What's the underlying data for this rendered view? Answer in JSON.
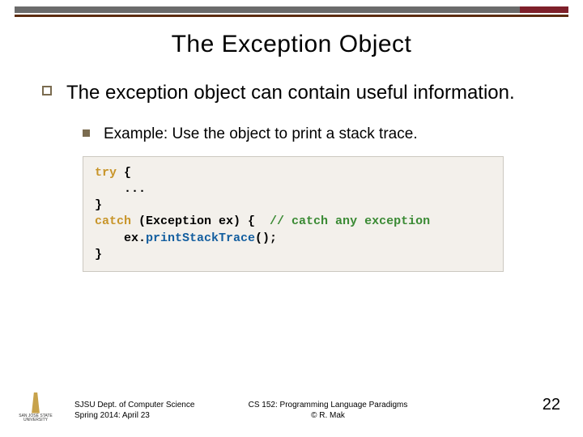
{
  "title": "The Exception Object",
  "bullets": {
    "main": "The exception object can contain useful information.",
    "sub_pre": "Example: Use the object to print a ",
    "sub_em": "stack trace",
    "sub_post": "."
  },
  "code": {
    "l1a": "try",
    "l1b": " {",
    "l2": "    ...",
    "l3": "}",
    "l4a": "catch",
    "l4b": " (Exception ex) {  ",
    "l4c": "// catch any exception",
    "l5a": "    ex.",
    "l5b": "printStackTrace",
    "l5c": "();",
    "l6": "}"
  },
  "footer": {
    "dept_line1": "SJSU Dept. of Computer Science",
    "dept_line2": "Spring 2014: April 23",
    "course_line1": "CS 152: Programming Language Paradigms",
    "course_line2": "© R. Mak",
    "logo_text": "SAN JOSÉ STATE UNIVERSITY",
    "page": "22"
  }
}
